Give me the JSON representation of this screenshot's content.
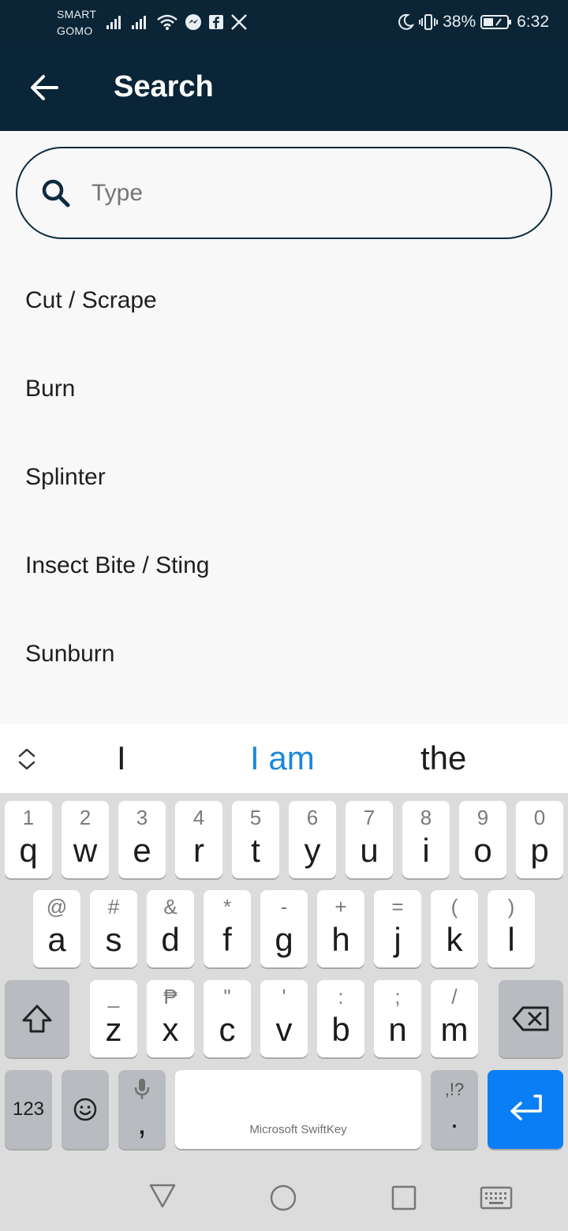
{
  "status_bar": {
    "carrier_line1": "SMART",
    "carrier_line2": "GOMO",
    "battery_percent": "38%",
    "time": "6:32",
    "left_icons": [
      "signal-bars-icon",
      "signal-bars-icon",
      "wifi-icon",
      "messenger-icon",
      "facebook-icon",
      "x-logo-icon"
    ],
    "right_icons": [
      "moon-icon",
      "vibrate-icon",
      "battery-icon"
    ]
  },
  "app_bar": {
    "title": "Search",
    "back_icon": "arrow-left-icon",
    "background": "#0a2538"
  },
  "search": {
    "placeholder": "Type",
    "value": "",
    "icon": "search-icon"
  },
  "results": [
    "Cut / Scrape",
    "Burn",
    "Splinter",
    "Insect Bite / Sting",
    "Sunburn"
  ],
  "keyboard": {
    "suggestions": [
      "I",
      "I am",
      "the"
    ],
    "active_suggestion_index": 1,
    "row1": [
      {
        "main": "q",
        "hint": "1"
      },
      {
        "main": "w",
        "hint": "2"
      },
      {
        "main": "e",
        "hint": "3"
      },
      {
        "main": "r",
        "hint": "4"
      },
      {
        "main": "t",
        "hint": "5"
      },
      {
        "main": "y",
        "hint": "6"
      },
      {
        "main": "u",
        "hint": "7"
      },
      {
        "main": "i",
        "hint": "8"
      },
      {
        "main": "o",
        "hint": "9"
      },
      {
        "main": "p",
        "hint": "0"
      }
    ],
    "row2": [
      {
        "main": "a",
        "hint": "@"
      },
      {
        "main": "s",
        "hint": "#"
      },
      {
        "main": "d",
        "hint": "&"
      },
      {
        "main": "f",
        "hint": "*"
      },
      {
        "main": "g",
        "hint": "-"
      },
      {
        "main": "h",
        "hint": "+"
      },
      {
        "main": "j",
        "hint": "="
      },
      {
        "main": "k",
        "hint": "("
      },
      {
        "main": "l",
        "hint": ")"
      }
    ],
    "row3": [
      {
        "main": "z",
        "hint": "_"
      },
      {
        "main": "x",
        "hint": "₱"
      },
      {
        "main": "c",
        "hint": "\""
      },
      {
        "main": "v",
        "hint": "'"
      },
      {
        "main": "b",
        "hint": ":"
      },
      {
        "main": "n",
        "hint": ";"
      },
      {
        "main": "m",
        "hint": "/"
      }
    ],
    "numbers_label": "123",
    "comma_label": ",",
    "space_label": "Microsoft SwiftKey",
    "period_hint": ",!?",
    "period_label": ".",
    "accent_color": "#0a7ef5"
  },
  "nav_bar": {
    "icons": [
      "back-triangle-icon",
      "home-circle-icon",
      "recents-square-icon",
      "keyboard-icon"
    ]
  }
}
